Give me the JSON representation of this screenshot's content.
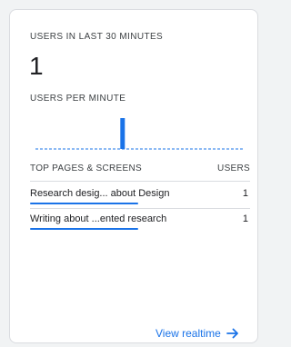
{
  "card": {
    "users_label": "USERS IN LAST 30 MINUTES",
    "users_value": "1",
    "per_minute_label": "USERS PER MINUTE",
    "table": {
      "col_pages": "TOP PAGES & SCREENS",
      "col_users": "USERS",
      "rows": [
        {
          "page": "Research desig... about Design",
          "users": "1",
          "share": 0.49
        },
        {
          "page": "Writing about ...ented research",
          "users": "1",
          "share": 0.49
        }
      ]
    },
    "realtime_link": "View realtime",
    "realtime_icon": "arrow-right-icon"
  },
  "chart_data": {
    "type": "bar",
    "title": "USERS PER MINUTE",
    "x": [
      "-30",
      "-29",
      "-28",
      "-27",
      "-26",
      "-25",
      "-24",
      "-23",
      "-22",
      "-21",
      "-20",
      "-19",
      "-18",
      "-17",
      "-16",
      "-15",
      "-14",
      "-13",
      "-12",
      "-11",
      "-10",
      "-9",
      "-8",
      "-7",
      "-6",
      "-5",
      "-4",
      "-3",
      "-2",
      "-1"
    ],
    "values": [
      0,
      0,
      0,
      0,
      0,
      0,
      0,
      0,
      0,
      0,
      0,
      0,
      1,
      0,
      0,
      0,
      0,
      0,
      0,
      0,
      0,
      0,
      0,
      0,
      0,
      0,
      0,
      0,
      0,
      0
    ],
    "ylim": [
      0,
      1
    ],
    "grid": false,
    "color": "#1a73e8"
  },
  "colors": {
    "accent": "#1a73e8",
    "text": "#202124",
    "muted": "#3c4043",
    "border": "#dadce0"
  }
}
